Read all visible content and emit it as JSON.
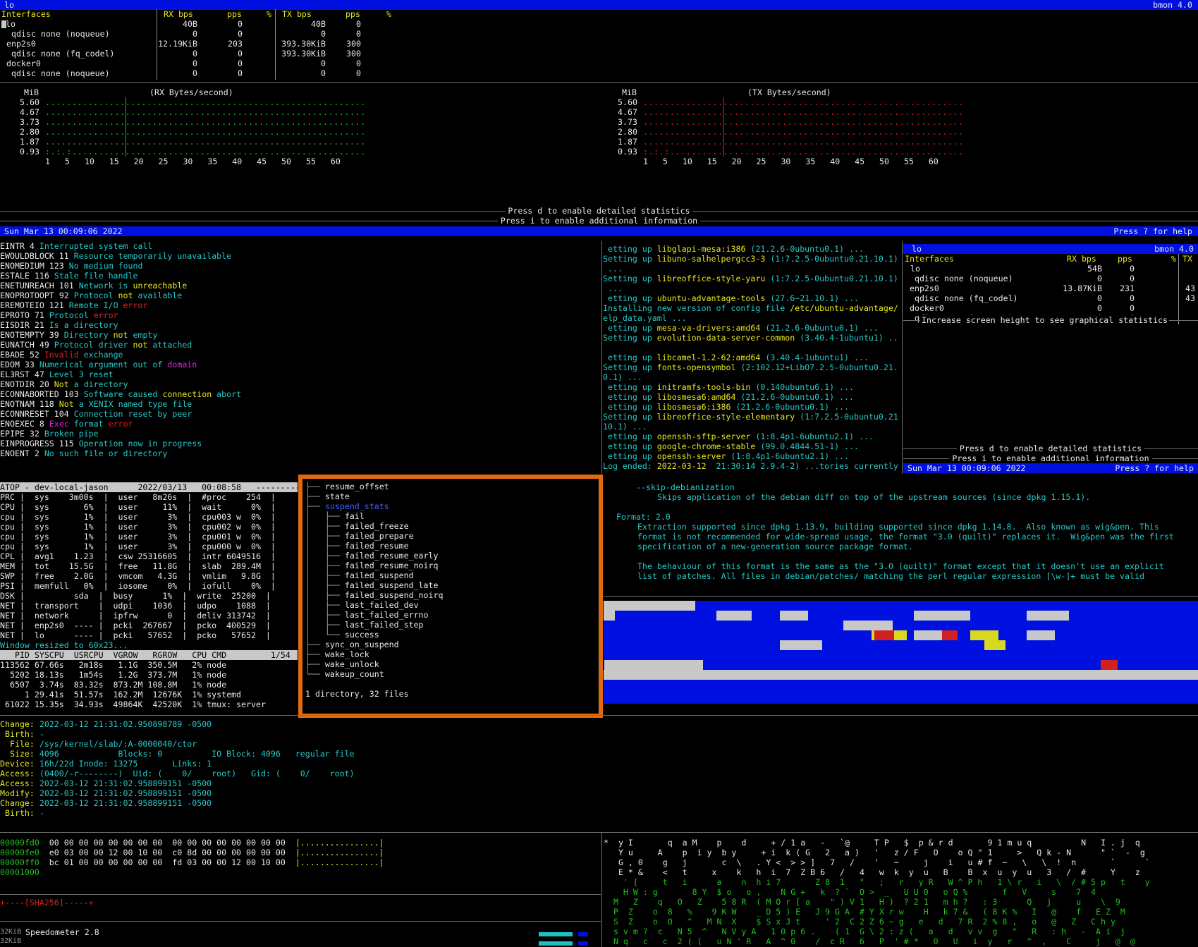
{
  "bmon_top": {
    "bar_left": "lo",
    "bar_right": "bmon 4.0",
    "header": {
      "ifaces": "Interfaces",
      "rxbps": "RX bps",
      "rxpps": "pps",
      "rxpct": "%",
      "txbps": "TX bps",
      "txpps": "pps",
      "txpct": "%"
    },
    "rows": [
      {
        "n": "lo",
        "rb": "40B",
        "rp": "0",
        "tb": "40B",
        "tp": "0"
      },
      {
        "n": "  qdisc none (noqueue)",
        "rb": "0",
        "rp": "0",
        "tb": "0",
        "tp": "0"
      },
      {
        "n": " enp2s0",
        "rb": "12.19KiB",
        "rp": "203",
        "tb": "393.30KiB",
        "tp": "300"
      },
      {
        "n": "  qdisc none (fq_codel)",
        "rb": "0",
        "rp": "0",
        "tb": "393.30KiB",
        "tp": "300"
      },
      {
        "n": " docker0",
        "rb": "0",
        "rp": "0",
        "tb": "0",
        "tp": "0"
      },
      {
        "n": "  qdisc none (noqueue)",
        "rb": "0",
        "rp": "0",
        "tb": "0",
        "tp": "0"
      }
    ],
    "rx_graph": {
      "unit": "MiB",
      "title": "(RX Bytes/second)",
      "yticks": [
        "5.60",
        "4.67",
        "3.73",
        "2.80",
        "1.87",
        "0.93"
      ],
      "xaxis": "1   5   10   15   20   25   30   35   40   45   50   55   60"
    },
    "tx_graph": {
      "unit": "MiB",
      "title": "(TX Bytes/second)",
      "yticks": [
        "5.60",
        "4.67",
        "3.73",
        "2.80",
        "1.87",
        "0.93"
      ],
      "xaxis": "1   5   10   15   20   25   30   35   40   45   50   55   60"
    },
    "hint_d": "Press d to enable detailed statistics",
    "hint_i": "Press i to enable additional information",
    "status_left": "Sun Mar 13 00:09:06 2022",
    "status_right": "Press ? for help"
  },
  "errno": [
    [
      "EINTR 4 ",
      "Interrupted system call"
    ],
    [
      "EWOULDBLOCK 11 ",
      "Resource temporarily unavailable"
    ],
    [
      "ENOMEDIUM 123 ",
      "No medium found"
    ],
    [
      "ESTALE 116 ",
      "Stale file handle"
    ],
    [
      "ENETUNREACH 101 ",
      "Network is unreachable"
    ],
    [
      "ENOPROTOOPT 92 ",
      "Protocol not available"
    ],
    [
      "EREMOTEIO 121 ",
      "Remote I/O error"
    ],
    [
      "EPROTO 71 ",
      "Protocol error"
    ],
    [
      "EISDIR 21 ",
      "Is a directory"
    ],
    [
      "ENOTEMPTY 39 ",
      "Directory not empty"
    ],
    [
      "EUNATCH 49 ",
      "Protocol driver not attached"
    ],
    [
      "EBADE 52 ",
      "Invalid exchange"
    ],
    [
      "EDOM 33 ",
      "Numerical argument out of domain"
    ],
    [
      "EL3RST 47 ",
      "Level 3 reset"
    ],
    [
      "ENOTDIR 20 ",
      "Not a directory"
    ],
    [
      "ECONNABORTED 103 ",
      "Software caused connection abort"
    ],
    [
      "ENOTNAM 118 ",
      "Not a XENIX named type file"
    ],
    [
      "ECONNRESET 104 ",
      "Connection reset by peer"
    ],
    [
      "ENOEXEC 8 ",
      "Exec format error"
    ],
    [
      "EPIPE 32 ",
      "Broken pipe"
    ],
    [
      "EINPROGRESS 115 ",
      "Operation now in progress"
    ],
    [
      "ENOENT 2 ",
      "No such file or directory"
    ]
  ],
  "apt": [
    " etting up libglapi-mesa:i386 (21.2.6-0ubuntu0.1) ...",
    "Setting up libuno-salhelpergcc3-3 (1:7.2.5-0ubuntu0.21.10.1)",
    " ...",
    "Setting up libreoffice-style-yaru (1:7.2.5-0ubuntu0.21.10.1)",
    " ...",
    " etting up ubuntu-advantage-tools (27.6~21.10.1) ...",
    "Installing new version of config file /etc/ubuntu-advantage/",
    "elp_data.yaml ...",
    " etting up mesa-va-drivers:amd64 (21.2.6-0ubuntu0.1) ...",
    "Setting up evolution-data-server-common (3.40.4-1ubuntu1) ..",
    "",
    " etting up libcamel-1.2-62:amd64 (3.40.4-1ubuntu1) ...",
    "Setting up fonts-opensymbol (2:102.12+LibO7.2.5-0ubuntu0.21.",
    "0.1) ...",
    " etting up initramfs-tools-bin (0.140ubuntu6.1) ...",
    " etting up libosmesa6:amd64 (21.2.6-0ubuntu0.1) ...",
    " etting up libosmesa6:i386 (21.2.6-0ubuntu0.1) ...",
    "Setting up libreoffice-style-elementary (1:7.2.5-0ubuntu0.21",
    "10.1) ...",
    " etting up openssh-sftp-server (1:8.4p1-6ubuntu2.1) ...",
    " etting up google-chrome-stable (99.0.4844.51-1) ...",
    " etting up openssh-server (1:8.4p1-6ubuntu2.1) ...",
    "Log ended: 2022-03-12  21:30:14 2.9.4-2) ...tories currently"
  ],
  "bmon_small": {
    "bar_left": "lo",
    "bar_right": "bmon 4.0",
    "header": {
      "ifaces": "Interfaces",
      "rxbps": "RX bps",
      "rxpps": "pps",
      "rxpct": "%",
      "tx": "TX"
    },
    "rows": [
      {
        "n": "lo",
        "rb": "54B",
        "rp": "0",
        "tx": ""
      },
      {
        "n": "  qdisc none (noqueue)",
        "rb": "0",
        "rp": "0",
        "tx": ""
      },
      {
        "n": " enp2s0",
        "rb": "13.87KiB",
        "rp": "231",
        "tx": "43"
      },
      {
        "n": "  qdisc none (fq_codel)",
        "rb": "0",
        "rp": "0",
        "tx": "43"
      },
      {
        "n": " docker0",
        "rb": "0",
        "rp": "0",
        "tx": ""
      },
      {
        "n": "  qdisc none (noqueue)",
        "rb": "0",
        "rp": "0",
        "tx": ""
      }
    ],
    "msg": "Increase screen height to see graphical statistics",
    "hint_d": "Press d to enable detailed statistics",
    "hint_i": "Press i to enable additional information",
    "status_left": "Sun Mar 13 00:09:06 2022",
    "status_right": "Press ? for help"
  },
  "atop": {
    "header": "ATOP - dev-local-jason      2022/03/13   00:08:58   ----------",
    "rows": [
      "PRC |  sys    3m00s  |  user   8m26s  |  #proc    254  |",
      "CPU |  sys       6%  |  user     11%  |  wait      0%  |",
      "cpu |  sys       1%  |  user      3%  |  cpu003 w  0%  |",
      "cpu |  sys       1%  |  user      3%  |  cpu002 w  0%  |",
      "cpu |  sys       1%  |  user      3%  |  cpu001 w  0%  |",
      "cpu |  sys       1%  |  user      3%  |  cpu000 w  0%  |",
      "CPL |  avg1    1.23  |  csw 25316605  |  intr 6049516  |",
      "MEM |  tot    15.5G  |  free   11.8G  |  slab  289.4M  |",
      "SWP |  free    2.0G  |  vmcom   4.3G  |  vmlim   9.8G  |",
      "PSI |  memfull   0%  |  iosome    0%  |  iofull    0%  |",
      "DSK |          sda  |  busy      1%  |  write  25200  |",
      "NET |  transport    |  udpi    1036  |  udpo    1088  |",
      "NET |  network      |  ipfrw      0  |  deliv 313742  |",
      "NET |  enp2s0  ---- |  pcki  267667  |  pcko  400529  |",
      "NET |  lo      ---- |  pcki   57652  |  pcko   57652  |"
    ],
    "resized": "Window resized to 60x23...",
    "proc_header": "   PID SYSCPU  USRCPU  VGROW   RGROW   CPU CMD         1/54",
    "procs": [
      "113562 67.66s   2m18s   1.1G  350.5M   2% node",
      "  5202 18.13s   1m54s   1.2G  373.7M   1% node",
      "  6507  3.74s  83.32s  873.2M 108.8M   1% node",
      "     1 29.41s  51.57s  162.2M  12676K  1% systemd",
      " 61022 15.35s  34.93s  49864K  42520K  1% tmux: server"
    ]
  },
  "tree": {
    "items": [
      "resume_offset",
      "state",
      "suspend_stats",
      "fail",
      "failed_freeze",
      "failed_prepare",
      "failed_resume",
      "failed_resume_early",
      "failed_resume_noirq",
      "failed_suspend",
      "failed_suspend_late",
      "failed_suspend_noirq",
      "last_failed_dev",
      "last_failed_errno",
      "last_failed_step",
      "success",
      "sync_on_suspend",
      "wake_lock",
      "wake_unlock",
      "wakeup_count"
    ],
    "summary": "1 directory, 32 files"
  },
  "man": {
    "l1": "--skip-debianization",
    "l2": "Skips application of the debian diff on top of the upstream sources (since dpkg 1.15.1).",
    "l3": "Format: 2.0",
    "l4": "Extraction supported since dpkg 1.13.9, building supported since dpkg 1.14.8.  Also known as wig&pen. This",
    "l5": "format is not recommended for wide-spread usage, the format \"3.0 (quilt)\" replaces it.  Wig&pen was the first",
    "l6": "specification of a new-generation source package format.",
    "l7": "The behaviour of this format is the same as the \"3.0 (quilt)\" format except that it doesn't use an explicit",
    "l8": "list of patches. All files in debian/patches/ matching the perl regular expression [\\w-]+ must be valid"
  },
  "stat": [
    [
      "Change: ",
      "2022-03-12 21:31:02.950898789 -0500"
    ],
    [
      " Birth: ",
      "-"
    ],
    [
      "  File: ",
      "/sys/kernel/slab/:A-0000040/ctor"
    ],
    [
      "  Size: ",
      "4096            Blocks: 0          IO Block: 4096   regular file"
    ],
    [
      "Device: ",
      "16h/22d Inode: 13275       Links: 1"
    ],
    [
      "Access: ",
      "(0400/-r--------)  Uid: (    0/    root)   Gid: (    0/    root)"
    ],
    [
      "Access: ",
      "2022-03-12 21:31:02.958899151 -0500"
    ],
    [
      "Modify: ",
      "2022-03-12 21:31:02.958899151 -0500"
    ],
    [
      "Change: ",
      "2022-03-12 21:31:02.958899151 -0500"
    ],
    [
      " Birth: ",
      "-"
    ]
  ],
  "hexdump": [
    [
      "00000fd0",
      "00 00 00 00 00 00 00 00  00 00 00 00 00 00 00 00",
      "|................|"
    ],
    [
      "00000fe0",
      "e0 03 00 00 12 00 10 00  c0 8d 00 00 00 00 00 00",
      "|................|"
    ],
    [
      "00000ff0",
      "bc 01 00 00 00 00 00 00  fd 03 00 00 12 00 10 00",
      "|................|"
    ],
    [
      "00001000",
      "",
      ""
    ]
  ],
  "sha": "+----[SHA256]-----+",
  "speed": {
    "label": "Speedometer 2.8",
    "unit1": "32KiB",
    "unit2": "32KiB"
  },
  "matrix": [
    "*  y I       q  a M    p    d     + / 1 a   -   `@     T P   $  p & r d       9 1 m u q          N   I . j  q",
    "   Y u     A    p  i y  b y     + i  k ( G   2   a )   '   z / F   O    o Q \" 1     >   Q k - N      \" `  -  g",
    "   G , 0    g   j       c  \\   . Y <  > > ]   7   /    '   ~     j    i   u # f  ~   \\   \\  !  n       `      `",
    "   E * &    <   t     x    k   h  i  7  Z B 6   /   4   w  k  y  u   B    B  x  u  y  u   3   /  #     Y    z",
    "    ' [     t   i      a    n  h i 7       Z 8  1   \"   ;   r   y R   W ^ P h   1 \\ r   i   \\  / # 5 p   t    y",
    "    H W : g       8 Y  $ o   o ,    N G +   k  ? `  O >  _   U U 0   o Q %       f   V     s    7  4",
    "  M   Z    q   O   Z    5 8 R  ( M O r [ a    \" ) V 1   H )  ? 2 1   m h ?   : 3      Q   j     u    \\  9",
    "  P  Z    o  8   %    9 K W    _ D 5 ) E   J 9 G A  # Y X r w    H   k 7 &   ( 8 K %   I   @    f   E Z  M",
    "  S  Z    o  O   ^   M N  X    $ S x J t     ' 2  C 2 Z 6 ~ g   e   d   7 R  2 % 8 ,   o   @   Z   C h y",
    "  s v m ?  c   N 5  ^   N V y A   1 0 p 6 .    ( 1  G \\ 2 : z (   a   d   v v  g   \"   R   : h   -  A i  j",
    "  N q   c   c  2 ( (   u N ' R   A  ^ 0    /  c R   6   P  ' # *   0   U   i  y   r   ^  ,    C     j   @  @"
  ]
}
